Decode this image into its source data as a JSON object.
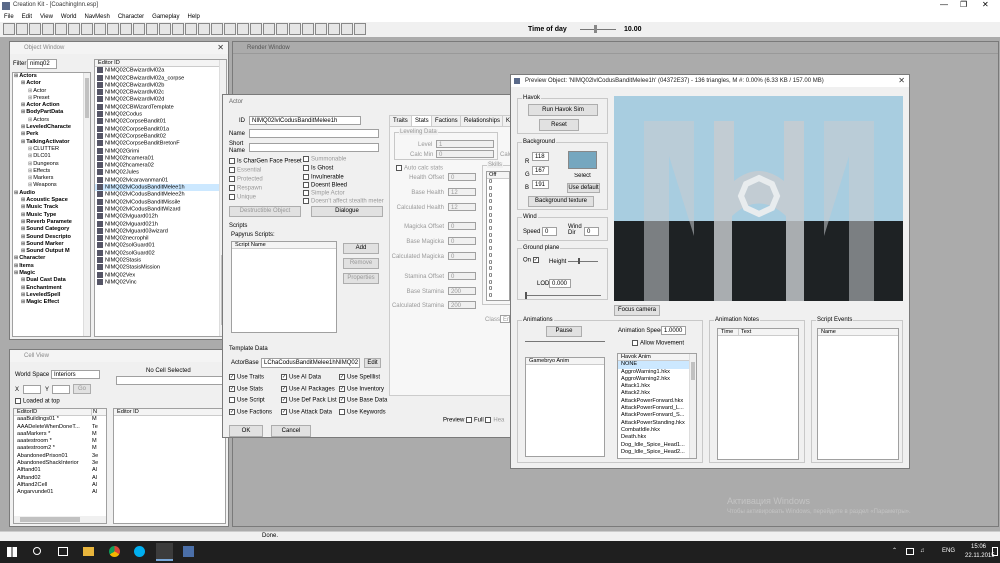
{
  "app": {
    "title": "Creation Kit - [CoachingInn.esp]",
    "menu": [
      "File",
      "Edit",
      "View",
      "World",
      "NavMesh",
      "Character",
      "Gameplay",
      "Help"
    ],
    "time_label": "Time of day",
    "time_value": "10.00",
    "status": "Done.",
    "toolbar_icons": [
      "new-icon",
      "open-icon",
      "save-icon",
      "preferences-icon",
      "undo-icon",
      "redo-icon",
      "cut-icon",
      "copy-icon",
      "paste-icon",
      "grid-icon",
      "angle-snap-icon",
      "navmesh-icon",
      "light-icon",
      "sky-icon",
      "fog-icon",
      "markers-icon",
      "objects-icon",
      "collision-icon",
      "bsa-icon",
      "warning-icon",
      "quest-icon",
      "voice-icon",
      "cell-icon",
      "weather-icon",
      "water-icon",
      "script-icon",
      "mirror-icon",
      "plane-icon"
    ]
  },
  "object_window": {
    "title": "Object Window",
    "filter_label": "Filter",
    "filter_value": "nimq02",
    "editor_id_header": "Editor ID",
    "tree": [
      {
        "t": "Actors",
        "l": 0,
        "b": 1
      },
      {
        "t": "Actor",
        "l": 1,
        "b": 1
      },
      {
        "t": "Actor",
        "l": 2
      },
      {
        "t": "Preset",
        "l": 2
      },
      {
        "t": "Actor Action",
        "l": 1,
        "b": 1
      },
      {
        "t": "BodyPartData",
        "l": 1,
        "b": 1
      },
      {
        "t": "Actors",
        "l": 2
      },
      {
        "t": "LeveledCharacte",
        "l": 1,
        "b": 1
      },
      {
        "t": "Perk",
        "l": 1,
        "b": 1
      },
      {
        "t": "TalkingActivator",
        "l": 1,
        "b": 1
      },
      {
        "t": "CLUTTER",
        "l": 2
      },
      {
        "t": "DLC01",
        "l": 2
      },
      {
        "t": "Dungeons",
        "l": 2
      },
      {
        "t": "Effects",
        "l": 2
      },
      {
        "t": "Markers",
        "l": 2
      },
      {
        "t": "Weapons",
        "l": 2
      },
      {
        "t": "Audio",
        "l": 0,
        "b": 1
      },
      {
        "t": "Acoustic Space",
        "l": 1,
        "b": 1
      },
      {
        "t": "Music Track",
        "l": 1,
        "b": 1
      },
      {
        "t": "Music Type",
        "l": 1,
        "b": 1
      },
      {
        "t": "Reverb Paramete",
        "l": 1,
        "b": 1
      },
      {
        "t": "Sound Category",
        "l": 1,
        "b": 1
      },
      {
        "t": "Sound Descripto",
        "l": 1,
        "b": 1
      },
      {
        "t": "Sound Marker",
        "l": 1,
        "b": 1
      },
      {
        "t": "Sound Output M",
        "l": 1,
        "b": 1
      },
      {
        "t": "Character",
        "l": 0,
        "b": 1
      },
      {
        "t": "Items",
        "l": 0,
        "b": 1
      },
      {
        "t": "Magic",
        "l": 0,
        "b": 1
      },
      {
        "t": "Dual Cast Data",
        "l": 1,
        "b": 1
      },
      {
        "t": "Enchantment",
        "l": 1,
        "b": 1
      },
      {
        "t": "LeveledSpell",
        "l": 1,
        "b": 1
      },
      {
        "t": "Magic Effect",
        "l": 1,
        "b": 1
      }
    ],
    "list": [
      "NIMQ02CBwizardlvl02a",
      "NIMQ02CBwizardlvl02a_corpse",
      "NIMQ02CBwizardlvl02b",
      "NIMQ02CBwizardlvl02c",
      "NIMQ02CBwizardlvl02d",
      "NIMQ02CBWizardTemplate",
      "NIMQ02Codus",
      "NIMQ02CorpseBandit01",
      "NIMQ02CorpseBandit01a",
      "NIMQ02CorpseBandit02",
      "NIMQ02CorpseBanditBretonF",
      "NIMQ02Grimi",
      "NIMQ02hcamera01",
      "NIMQ02hcamera02",
      "NIMQ02Jules",
      "NIMQ02lvlcaravanman01",
      "NIMQ02lvlCodusBanditMelee1h",
      "NIMQ02lvlCodusBanditMelee2h",
      "NIMQ02lvlCodusBanditMissile",
      "NIMQ02lvlCodusBanditWizard",
      "NIMQ02lvlguard012h",
      "NIMQ02lvlguard021h",
      "NIMQ02lvlguard03wizard",
      "NIMQ02necrophil",
      "NIMQ02solGuard01",
      "NIMQ02solGuard02",
      "NIMQ02Stasis",
      "NIMQ02StasisMission",
      "NIMQ02Vex",
      "NIMQ02Vinc"
    ],
    "selected": 16
  },
  "cell_view": {
    "title": "Cell View",
    "worldspace_label": "World Space",
    "worldspace_value": "Interiors",
    "no_cell": "No Cell Selected",
    "x_label": "X",
    "y_label": "Y",
    "go": "Go",
    "loaded_label": "Loaded at top",
    "col_editor": "EditorID",
    "col_n": "N",
    "col_editor2": "Editor ID",
    "rows": [
      [
        "aaaBuildings01 *",
        "M"
      ],
      [
        "AAADeleteWhenDoneT...",
        "Te"
      ],
      [
        "aaaMarkers *",
        "M"
      ],
      [
        "aaatestroom *",
        "M"
      ],
      [
        "aaatestroom2 *",
        "M"
      ],
      [
        "AbandonedPrison01",
        "3e"
      ],
      [
        "AbandonedShackInterior",
        "3e"
      ],
      [
        "Alftand01",
        "Al"
      ],
      [
        "Alftand02",
        "Al"
      ],
      [
        "Alftand2Cell",
        "Al"
      ],
      [
        "Angarvunde01",
        "Al"
      ]
    ]
  },
  "render_window": {
    "title": "Render Window"
  },
  "actor": {
    "title": "Actor",
    "id_label": "ID",
    "id_value": "NIMQ02lvlCodusBanditMelee1h",
    "name_label": "Name",
    "short_label": "Short Name",
    "chargen": "Is CharGen Face Preset",
    "essential": "Essential",
    "protected": "Protected",
    "respawn": "Respawn",
    "unique": "Unique",
    "summonable": "Summonable",
    "is_ghost": "Is Ghost",
    "invulnerable": "Invulnerable",
    "doesnt_bleed": "Doesnt Bleed",
    "simple_actor": "Simple Actor",
    "no_stealth": "Doesn't affect stealth meter",
    "destructible": "Destructible Object",
    "dialogue": "Dialogue",
    "scripts": "Scripts",
    "papyrus": "Papyrus Scripts:",
    "script_name": "Script Name",
    "add": "Add",
    "remove": "Remove",
    "properties": "Properties",
    "template_data": "Template Data",
    "actor_base_label": "ActorBase",
    "actor_base_value": "LChaCodusBanditMelee1hNIMQ02",
    "edit": "Edit",
    "use": [
      [
        "Use Traits",
        "Use AI Data",
        "Use Spelllist"
      ],
      [
        "Use Stats",
        "Use AI Packages",
        "Use Inventory"
      ],
      [
        "Use Script",
        "Use Def Pack List",
        "Use Base Data"
      ],
      [
        "Use Factions",
        "Use Attack Data",
        "Use Keywords"
      ]
    ],
    "use_checked": [
      [
        true,
        true,
        true
      ],
      [
        true,
        true,
        true
      ],
      [
        false,
        true,
        true
      ],
      [
        true,
        true,
        false
      ]
    ],
    "ok": "OK",
    "cancel": "Cancel",
    "tabs": [
      "Traits",
      "Stats",
      "Factions",
      "Relationships",
      "Ke"
    ],
    "leveling": "Leveling Data",
    "level": "Level",
    "level_value": "1",
    "calc_min": "Calc Min",
    "calc_min_value": "0",
    "calc_ma": "Calc M",
    "auto_calc": "Auto calc stats",
    "skills": "Skills",
    "off": "Off",
    "stats": [
      [
        "Health Offset",
        "0"
      ],
      [
        "Base Health",
        "12"
      ],
      [
        "Calculated Health",
        "12"
      ],
      [
        "Magicka Offset",
        "0"
      ],
      [
        "Base Magicka",
        "0"
      ],
      [
        "Calculated Magicka",
        "0"
      ],
      [
        "Stamina Offset",
        "0"
      ],
      [
        "Base Stamina",
        "200"
      ],
      [
        "Calculated Stamina",
        "200"
      ]
    ],
    "zeros": [
      "0",
      "0",
      "0",
      "0",
      "0",
      "0",
      "0",
      "0",
      "0",
      "0",
      "0",
      "0",
      "0",
      "0",
      "0",
      "0",
      "0",
      "0"
    ],
    "b_label": "B",
    "class": "Class",
    "class_value": "En",
    "preview": "Preview",
    "full": "Full",
    "head": "Hea"
  },
  "preview": {
    "title": "Preview Object: 'NIMQ02lvlCodusBanditMelee1h' (04372E37) - 136 triangles, M #: 0.00% (6.33 KB / 157.00 MB)",
    "havok": "Havok",
    "run_havok": "Run Havok Sim",
    "reset": "Reset",
    "background": "Background",
    "r": "118",
    "g": "167",
    "b": "191",
    "select": "Select",
    "use_default": "Use default",
    "bg_texture": "Background texture",
    "wind": "Wind",
    "speed_label": "Speed",
    "speed_value": "0",
    "wind_dir_label": "Wind Dir",
    "wind_dir_value": "0",
    "ground": "Ground plane",
    "on": "On",
    "height": "Height",
    "lod": "LOD",
    "lod_value": "0.000",
    "focus": "Focus camera",
    "animations": "Animations",
    "pause": "Pause",
    "anim_speed": "Animation Speed",
    "anim_speed_value": "1.0000",
    "allow_movement": "Allow Movement",
    "gamebryo": "Gamebryo Anim",
    "havok_anim": "Havok Anim",
    "anims": [
      "NONE",
      "AggroWarning1.hkx",
      "AggroWarning2.hkx",
      "Attack1.hkx",
      "Attack2.hkx",
      "AttackPowerForward.hkx",
      "AttackPowerForward_L...",
      "AttackPowerForward_S...",
      "AttackPowerStanding.hkx",
      "CombatIdle.hkx",
      "Death.hkx",
      "Dog_Idle_Spice_Head1...",
      "Dog_Idle_Spice_Head2..."
    ],
    "notes": "Animation Notes",
    "time": "Time",
    "text": "Text",
    "events": "Script Events",
    "name": "Name",
    "colors": {
      "sky": "#a8cde0",
      "ground": "#1e2224",
      "model": "#c8ccd0",
      "swatch": "#76a7bf"
    }
  },
  "watermark": {
    "line1": "Активация Windows",
    "line2": "Чтобы активировать Windows, перейдите в раздел «Параметры»."
  },
  "taskbar": {
    "lang": "ENG",
    "time": "15:06",
    "date": "22.11.2015"
  }
}
